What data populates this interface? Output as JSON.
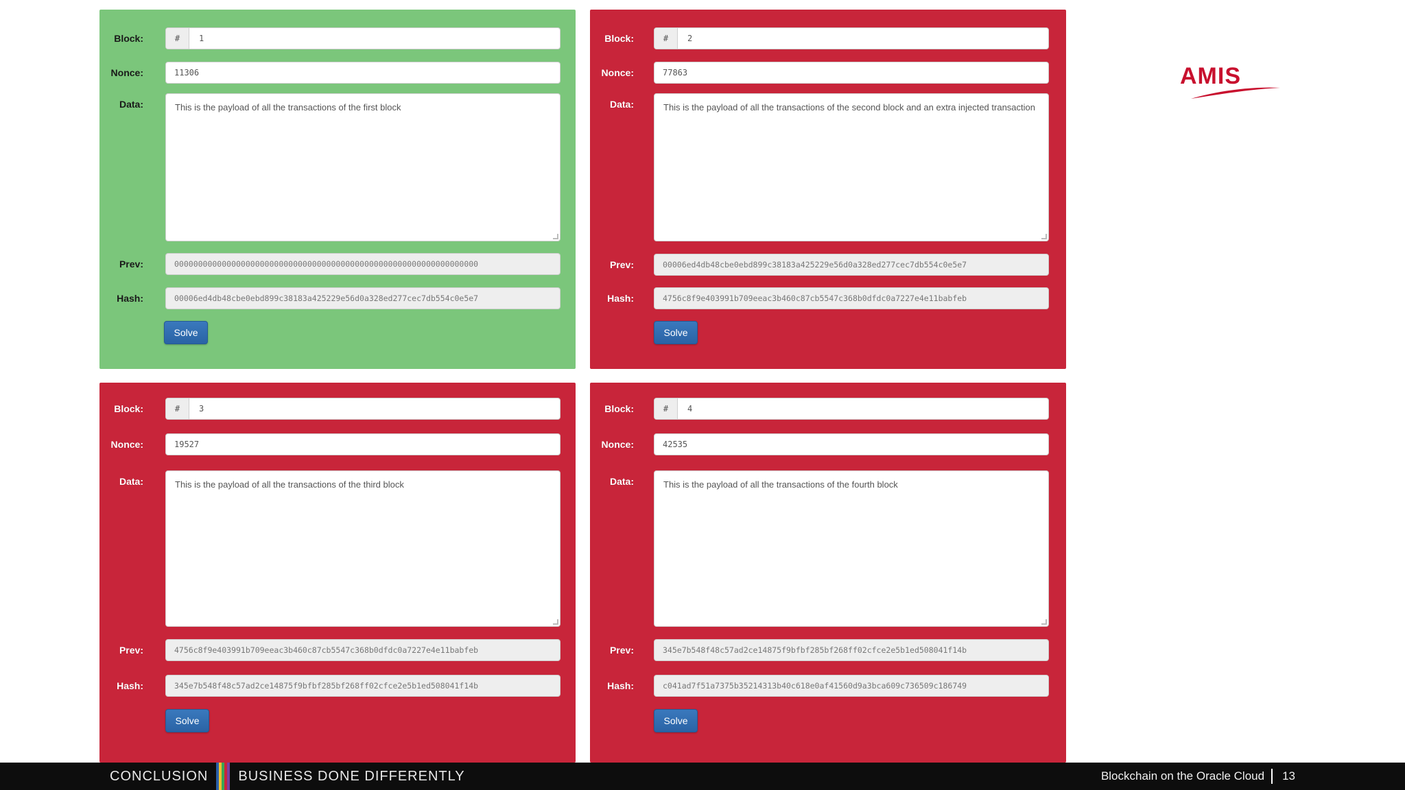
{
  "labels": {
    "block": "Block:",
    "nonce": "Nonce:",
    "data": "Data:",
    "prev": "Prev:",
    "hash": "Hash:",
    "hash_addon": "#",
    "solve": "Solve"
  },
  "colors": {
    "valid": "#7bc67b",
    "invalid": "#c8253a",
    "solve_button": "#2a63a5"
  },
  "blocks": [
    {
      "status": "valid",
      "number": "1",
      "nonce": "11306",
      "data": "This is the payload of all the transactions of the first block",
      "prev": "0000000000000000000000000000000000000000000000000000000000000000",
      "hash": "00006ed4db48cbe0ebd899c38183a425229e56d0a328ed277cec7db554c0e5e7"
    },
    {
      "status": "invalid",
      "number": "2",
      "nonce": "77863",
      "data": "This is the payload of all the transactions of the second block and an extra injected transaction",
      "prev": "00006ed4db48cbe0ebd899c38183a425229e56d0a328ed277cec7db554c0e5e7",
      "hash": "4756c8f9e403991b709eeac3b460c87cb5547c368b0dfdc0a7227e4e11babfeb"
    },
    {
      "status": "invalid",
      "number": "3",
      "nonce": "19527",
      "data": "This is the payload of all the transactions of the third block",
      "prev": "4756c8f9e403991b709eeac3b460c87cb5547c368b0dfdc0a7227e4e11babfeb",
      "hash": "345e7b548f48c57ad2ce14875f9bfbf285bf268ff02cfce2e5b1ed508041f14b"
    },
    {
      "status": "invalid",
      "number": "4",
      "nonce": "42535",
      "data": "This is the payload of all the transactions of the fourth block",
      "prev": "345e7b548f48c57ad2ce14875f9bfbf285bf268ff02cfce2e5b1ed508041f14b",
      "hash": "c041ad7f51a7375b35214313b40c618e0af41560d9a3bca609c736509c186749"
    }
  ],
  "logo": {
    "text": "AMIS"
  },
  "footer": {
    "section": "CONCLUSION",
    "tagline": "BUSINESS DONE DIFFERENTLY",
    "stripe_colors": [
      "#2b5fa8",
      "#f2c12e",
      "#3aa655",
      "#c8253a",
      "#7b3fa0"
    ],
    "title": "Blockchain on the Oracle Cloud",
    "page": "13"
  }
}
